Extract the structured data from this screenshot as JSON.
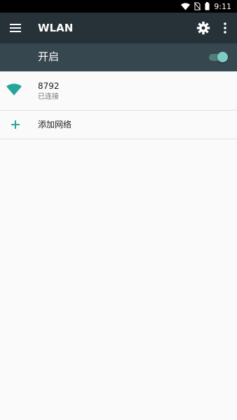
{
  "status_bar": {
    "time": "9:11",
    "icons": [
      "wifi-icon",
      "no-sim-icon",
      "battery-icon"
    ]
  },
  "toolbar": {
    "title": "WLAN",
    "menu_icon": "menu-icon",
    "settings_icon": "gear-icon",
    "more_icon": "more-vert-icon"
  },
  "wifi_switch": {
    "label": "开启",
    "enabled": true,
    "accent_color": "#80cbc4"
  },
  "networks": [
    {
      "name": "8792",
      "status": "已连接",
      "icon": "wifi-signal-icon"
    }
  ],
  "add_network": {
    "label": "添加网络",
    "icon": "plus-icon"
  },
  "colors": {
    "toolbar": "#263238",
    "switch_bar": "#37474f",
    "accent": "#26a69a"
  }
}
